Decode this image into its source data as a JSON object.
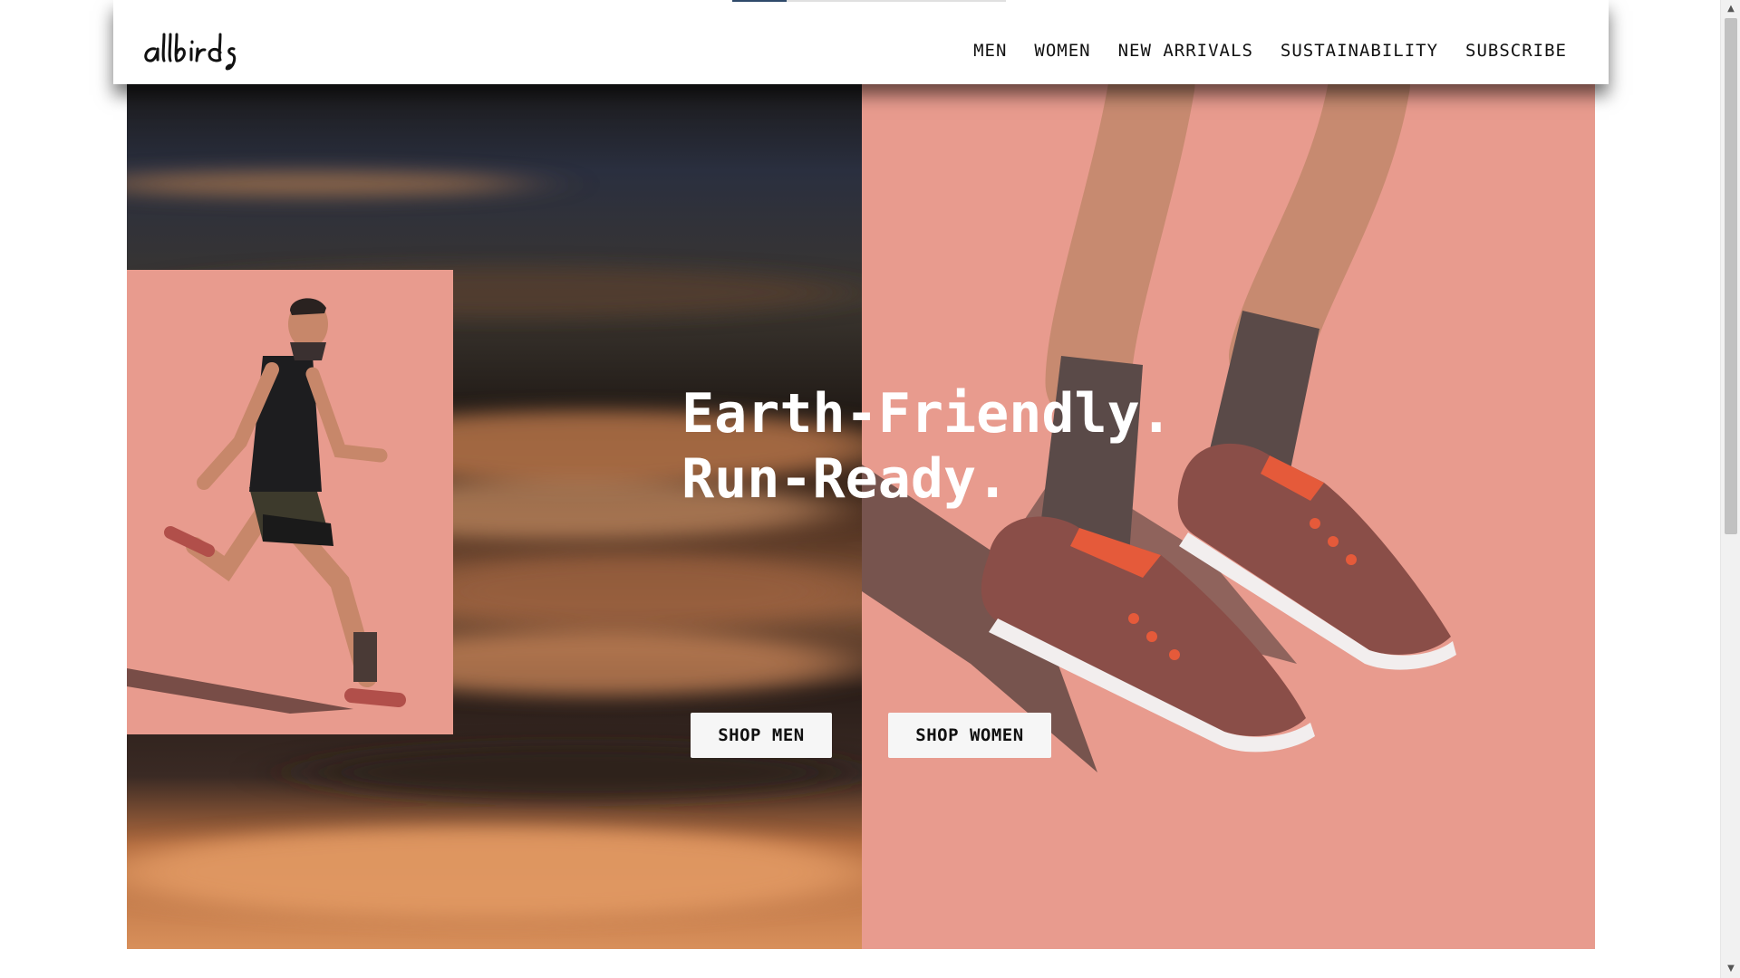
{
  "header": {
    "logo_text": "allbirds",
    "nav": [
      {
        "label": "MEN"
      },
      {
        "label": "WOMEN"
      },
      {
        "label": "NEW ARRIVALS"
      },
      {
        "label": "SUSTAINABILITY"
      },
      {
        "label": "SUBSCRIBE"
      }
    ]
  },
  "progress": {
    "fraction": 0.2
  },
  "hero": {
    "title_line1": "Earth-Friendly.",
    "title_line2": "Run-Ready.",
    "shop_men": "SHOP MEN",
    "shop_women": "SHOP WOMEN",
    "accent_color": "#e89b8e"
  },
  "icons": {
    "scroll_up": "up-arrow-icon",
    "scroll_down": "down-arrow-icon"
  }
}
